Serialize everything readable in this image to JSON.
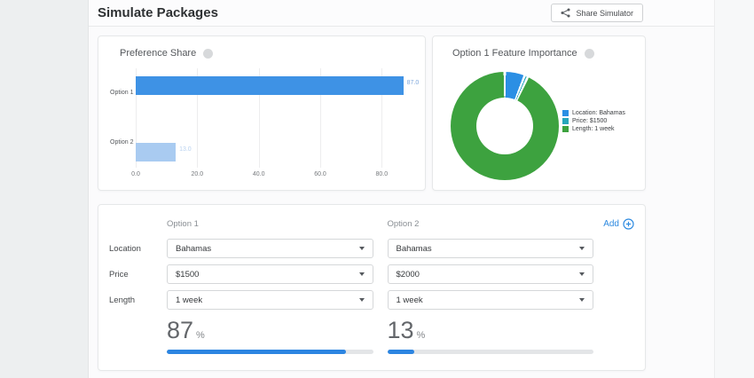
{
  "header": {
    "title": "Simulate Packages",
    "share_button_label": "Share Simulator"
  },
  "preference_share_card": {
    "title": "Preference Share"
  },
  "feature_importance_card": {
    "title": "Option 1 Feature Importance"
  },
  "simulator": {
    "columns": [
      "Option 1",
      "Option 2"
    ],
    "add_label": "Add",
    "rows": [
      {
        "label": "Location",
        "values": [
          "Bahamas",
          "Bahamas"
        ]
      },
      {
        "label": "Price",
        "values": [
          "$1500",
          "$2000"
        ]
      },
      {
        "label": "Length",
        "values": [
          "1 week",
          "1 week"
        ]
      }
    ],
    "results": [
      {
        "value": "87",
        "unit": "%",
        "percent": 87
      },
      {
        "value": "13",
        "unit": "%",
        "percent": 13
      }
    ],
    "accent_color": "#2c85e1"
  },
  "chart_data": [
    {
      "type": "bar",
      "orientation": "horizontal",
      "title": "Preference Share",
      "categories": [
        "Option 1",
        "Option 2"
      ],
      "values": [
        87.0,
        13.0
      ],
      "value_labels": [
        "87.0",
        "13.0"
      ],
      "bar_colors": [
        "#3e92e5",
        "#a9cbf1"
      ],
      "value_label_colors": [
        "#7fa8dc",
        "#b9d2f0"
      ],
      "xtick_values": [
        0,
        20,
        40,
        60,
        80
      ],
      "xtick_labels": [
        "0.0",
        "20.0",
        "40.0",
        "60.0",
        "80.0"
      ],
      "xlim": [
        0,
        90
      ],
      "grid": true,
      "legend": false
    },
    {
      "type": "pie",
      "subtype": "donut",
      "title": "Option 1 Feature Importance",
      "labels": [
        "Location: Bahamas",
        "Price: $1500",
        "Length: 1 week"
      ],
      "values_pct": [
        6,
        1,
        93
      ],
      "colors": [
        "#2b8fe4",
        "#27a6bc",
        "#3da23f"
      ],
      "legend_position": "right"
    }
  ]
}
